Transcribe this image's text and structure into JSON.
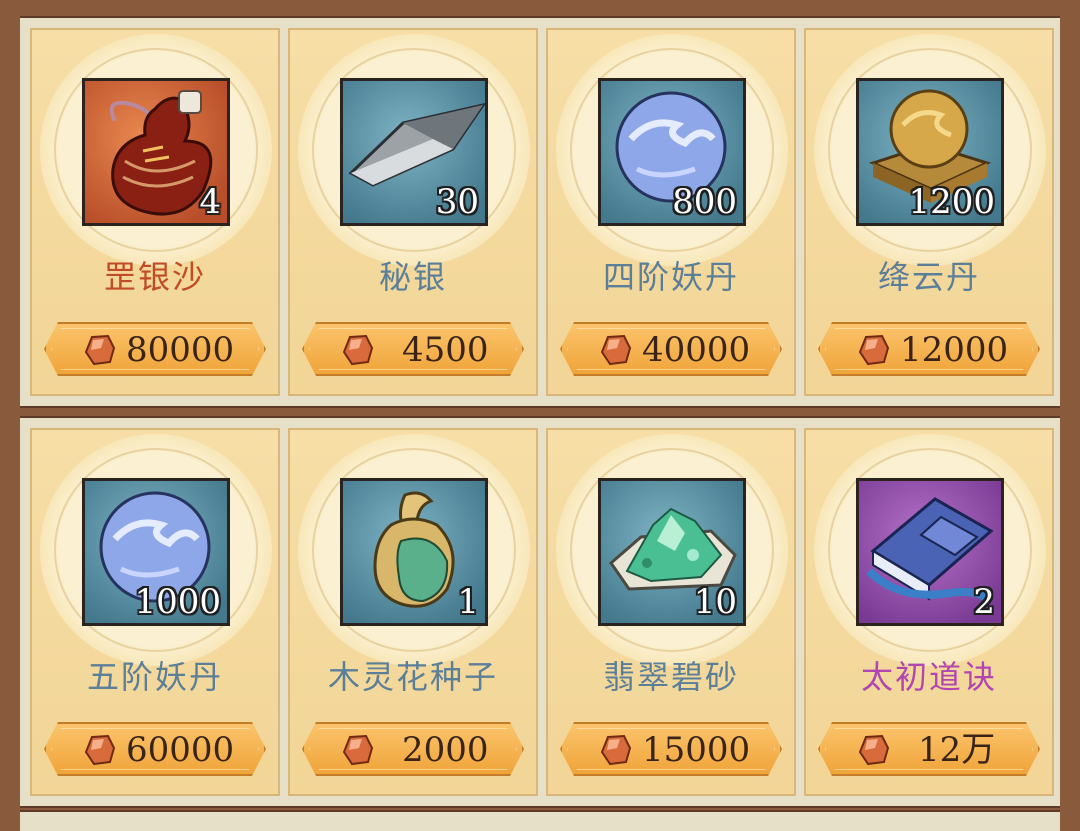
{
  "shop": {
    "items": [
      {
        "name": "罡银沙",
        "qty": "4",
        "price": "80000",
        "name_color": "#c14b27",
        "bg": "orange",
        "icon": "gourd-icon"
      },
      {
        "name": "秘银",
        "qty": "30",
        "price": "4500",
        "name_color": "#5b7f99",
        "bg": "blue",
        "icon": "silver-ingot-icon"
      },
      {
        "name": "四阶妖丹",
        "qty": "800",
        "price": "40000",
        "name_color": "#5b7f99",
        "bg": "blue",
        "icon": "demon-pill-icon"
      },
      {
        "name": "绛云丹",
        "qty": "1200",
        "price": "12000",
        "name_color": "#5b7f99",
        "bg": "blue",
        "icon": "golden-pill-icon"
      },
      {
        "name": "五阶妖丹",
        "qty": "1000",
        "price": "60000",
        "name_color": "#5b7f99",
        "bg": "blue",
        "icon": "demon-pill-icon"
      },
      {
        "name": "木灵花种子",
        "qty": "1",
        "price": "2000",
        "name_color": "#5b7f99",
        "bg": "blue",
        "icon": "seed-pouch-icon"
      },
      {
        "name": "翡翠碧砂",
        "qty": "10",
        "price": "15000",
        "name_color": "#5b7f99",
        "bg": "blue",
        "icon": "jade-sand-icon"
      },
      {
        "name": "太初道诀",
        "qty": "2",
        "price": "12万",
        "name_color": "#b246b1",
        "bg": "purple",
        "icon": "scripture-book-icon"
      }
    ],
    "currency_icon": "spirit-stone-icon"
  }
}
